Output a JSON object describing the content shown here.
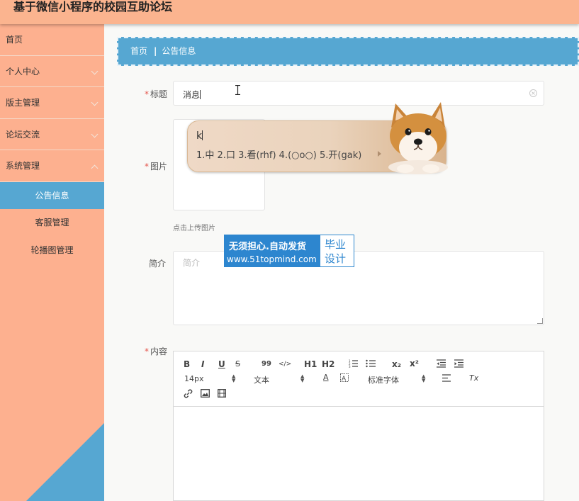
{
  "header": {
    "title": "基于微信小程序的校园互助论坛"
  },
  "sidebar": {
    "items": [
      {
        "label": "首页",
        "expandable": false
      },
      {
        "label": "个人中心",
        "expandable": true
      },
      {
        "label": "版主管理",
        "expandable": true
      },
      {
        "label": "论坛交流",
        "expandable": true
      },
      {
        "label": "系统管理",
        "expandable": true,
        "open": true
      }
    ],
    "subitems": [
      {
        "label": "公告信息",
        "active": true
      },
      {
        "label": "客服管理",
        "active": false
      },
      {
        "label": "轮播图管理",
        "active": false
      }
    ]
  },
  "breadcrumb": {
    "home": "首页",
    "separator": "|",
    "current": "公告信息"
  },
  "form": {
    "title_label": "标题",
    "title_value": "消息",
    "image_label": "图片",
    "upload_hint": "点击上传图片",
    "intro_label": "简介",
    "intro_placeholder": "简介",
    "content_label": "内容",
    "required_mark": "*"
  },
  "editor": {
    "toolbar": {
      "bold": "B",
      "italic": "I",
      "underline": "U",
      "strike": "S",
      "quote": "99",
      "code": "</>",
      "h1": "H1",
      "h2": "H2",
      "sub": "x₂",
      "sup": "x²",
      "font_size": "14px",
      "text_type": "文本",
      "font_family": "标准字体",
      "font_color": "A",
      "clear_format": "Tx"
    }
  },
  "ime": {
    "composition": "k",
    "candidates": "1.中  2.口  3.看(rhf)  4.(○o○)  5.开(gak)"
  },
  "watermark": {
    "line1": "无须担心.自动发货",
    "line2": "www.51topmind.com",
    "box_line1": "毕业",
    "box_line2": "设计"
  },
  "colors": {
    "header": "#fbb48f",
    "sidebar": "#fdb08f",
    "accent": "#56a7d2"
  }
}
